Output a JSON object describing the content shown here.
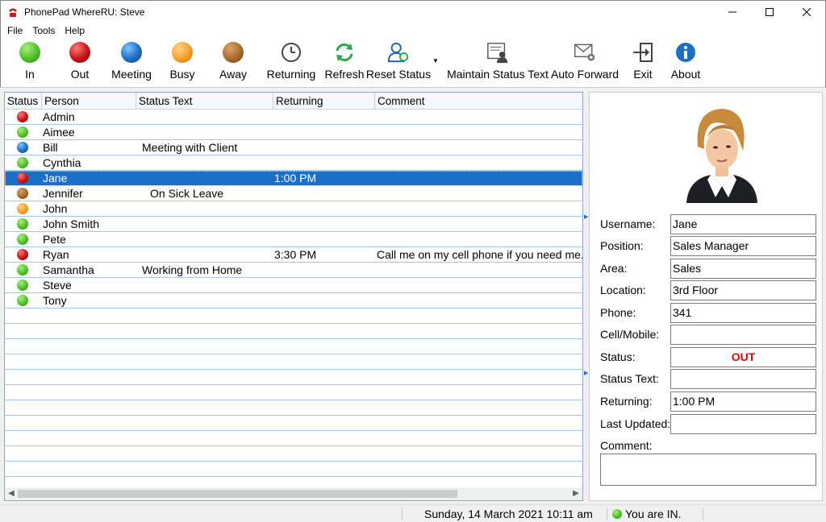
{
  "window": {
    "title": "PhonePad WhereRU: Steve",
    "minimize": "—",
    "maximize": "☐",
    "close": "✕"
  },
  "menu": [
    "File",
    "Tools",
    "Help"
  ],
  "toolbar": {
    "in": "In",
    "out": "Out",
    "meeting": "Meeting",
    "busy": "Busy",
    "away": "Away",
    "returning": "Returning",
    "refresh": "Refresh",
    "reset_status": "Reset Status",
    "maintain_status_text": "Maintain Status Text",
    "auto_forward": "Auto Forward",
    "exit": "Exit",
    "about": "About"
  },
  "colors": {
    "in": "#4fbf2a",
    "out": "#c41414",
    "meeting": "#1c6fc4",
    "busy": "#f5a028",
    "away": "#a86a2c",
    "selected": "#1b6fc9",
    "status_out": "#e00000"
  },
  "list": {
    "headers": {
      "status": "Status",
      "person": "Person",
      "status_text": "Status Text",
      "returning": "Returning",
      "comment": "Comment"
    },
    "rows": [
      {
        "status": "out",
        "person": "Admin",
        "status_text": "",
        "returning": "",
        "comment": ""
      },
      {
        "status": "in",
        "person": "Aimee",
        "status_text": "",
        "returning": "",
        "comment": ""
      },
      {
        "status": "meeting",
        "person": "Bill",
        "status_text": "Meeting with Client",
        "returning": "",
        "comment": ""
      },
      {
        "status": "in",
        "person": "Cynthia",
        "status_text": "",
        "returning": "",
        "comment": ""
      },
      {
        "status": "out",
        "person": "Jane",
        "status_text": "",
        "returning": "1:00 PM",
        "comment": "",
        "selected": true
      },
      {
        "status": "away",
        "person": "Jennifer",
        "status_text": "On Sick Leave",
        "returning": "",
        "comment": ""
      },
      {
        "status": "busy",
        "person": "John",
        "status_text": "",
        "returning": "",
        "comment": ""
      },
      {
        "status": "in",
        "person": "John Smith",
        "status_text": "",
        "returning": "",
        "comment": ""
      },
      {
        "status": "in",
        "person": "Pete",
        "status_text": "",
        "returning": "",
        "comment": ""
      },
      {
        "status": "out",
        "person": "Ryan",
        "status_text": "",
        "returning": "3:30 PM",
        "comment": "Call me on my cell phone if you need me."
      },
      {
        "status": "in",
        "person": "Samantha",
        "status_text": "Working from Home",
        "returning": "",
        "comment": ""
      },
      {
        "status": "in",
        "person": "Steve",
        "status_text": "",
        "returning": "",
        "comment": ""
      },
      {
        "status": "in",
        "person": "Tony",
        "status_text": "",
        "returning": "",
        "comment": ""
      }
    ]
  },
  "details": {
    "username_label": "Username:",
    "username": "Jane",
    "position_label": "Position:",
    "position": "Sales Manager",
    "area_label": "Area:",
    "area": "Sales",
    "location_label": "Location:",
    "location": "3rd Floor",
    "phone_label": "Phone:",
    "phone": "341",
    "cell_label": "Cell/Mobile:",
    "cell": "",
    "status_label": "Status:",
    "status": "OUT",
    "status_text_label": "Status Text:",
    "status_text": "",
    "returning_label": "Returning:",
    "returning": "1:00 PM",
    "last_updated_label": "Last Updated:",
    "last_updated": "",
    "comment_label": "Comment:",
    "comment": ""
  },
  "statusbar": {
    "datetime": "Sunday, 14 March 2021  10:11 am",
    "presence": "You are IN."
  }
}
